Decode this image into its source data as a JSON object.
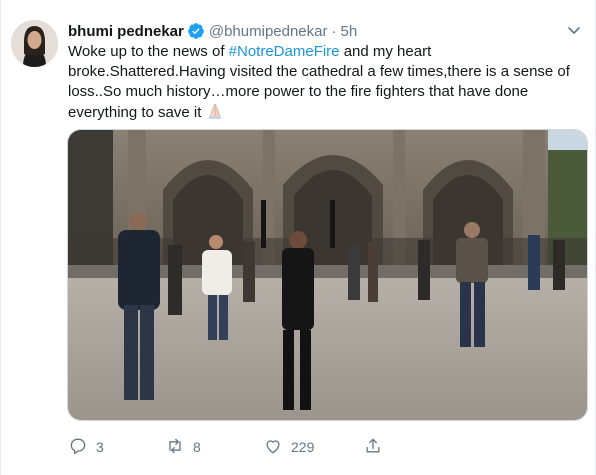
{
  "tweet": {
    "author_name": "bhumi pednekar",
    "handle": "@bhumipednekar",
    "separator": "·",
    "time": "5h",
    "text_before_hashtag": "Woke up to the news of ",
    "hashtag": "#NotreDameFire",
    "text_after_hashtag": "  and my heart broke.Shattered.Having visited the cathedral a few times,there is a sense of loss..So much history…more power to the fire fighters that have done everything to save it ",
    "emoji": "folded-hands-emoji"
  },
  "actions": {
    "reply_count": "3",
    "retweet_count": "8",
    "like_count": "229"
  },
  "icons": [
    "verified-badge-icon",
    "chevron-down-icon",
    "reply-icon",
    "retweet-icon",
    "like-icon",
    "share-icon"
  ],
  "colors": {
    "link": "#1b95e0",
    "verified": "#1da1f2",
    "secondary_text": "#657786",
    "primary_text": "#14171a"
  }
}
